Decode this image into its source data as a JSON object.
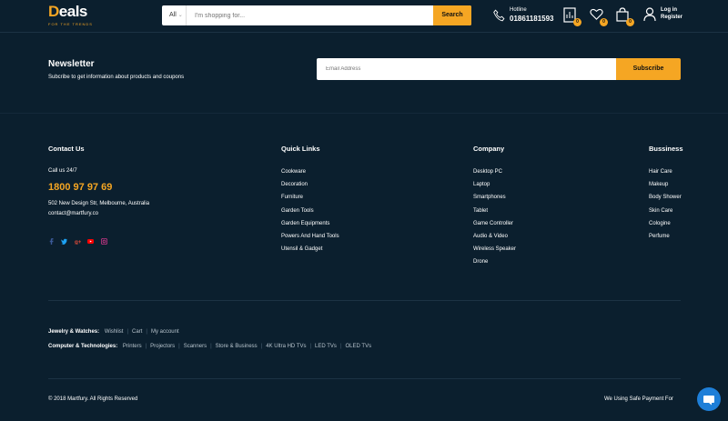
{
  "header": {
    "logo": {
      "text_prefix": "D",
      "text_rest": "eals",
      "tagline": "FOR THE TRENDS"
    },
    "search": {
      "category": "All",
      "placeholder": "I'm shopping for...",
      "button_label": "Search"
    },
    "hotline": {
      "label": "Hotline",
      "number": "01861181593",
      "icon": "phone-icon"
    },
    "icons": [
      {
        "name": "compare-icon",
        "badge": "0"
      },
      {
        "name": "wishlist-icon",
        "badge": "0"
      },
      {
        "name": "cart-icon",
        "badge": "0"
      }
    ],
    "account": {
      "login": "Log in",
      "register": "Register",
      "icon": "user-icon"
    }
  },
  "newsletter": {
    "title": "Newsletter",
    "subtitle": "Subcribe to get information about products and coupons",
    "email_placeholder": "Email Address",
    "button_label": "Subscribe"
  },
  "contact": {
    "title": "Contact Us",
    "call_label": "Call us 24/7",
    "phone": "1800 97 97 69",
    "address": "502 New Design Str, Melbourne, Australia",
    "email": "contact@martfury.co",
    "social": [
      {
        "name": "facebook-icon",
        "color": "#3b5998"
      },
      {
        "name": "twitter-icon",
        "color": "#1da1f2"
      },
      {
        "name": "google-plus-icon",
        "color": "#dd4b39"
      },
      {
        "name": "youtube-icon",
        "color": "#ff0000"
      },
      {
        "name": "instagram-icon",
        "color": "#c13584"
      }
    ]
  },
  "quick_links": {
    "title": "Quick Links",
    "items": [
      "Cookware",
      "Decoration",
      "Furniture",
      "Garden Tools",
      "Garden Equipments",
      "Powers And Hand Tools",
      "Utensil & Gadget"
    ]
  },
  "company": {
    "title": "Company",
    "items": [
      "Desktop PC",
      "Laptop",
      "Smartphones",
      "Tablet",
      "Game Controller",
      "Audio & Video",
      "Wireless Speaker",
      "Drone"
    ]
  },
  "business": {
    "title": "Bussiness",
    "items": [
      "Hair Care",
      "Makeup",
      "Body Shower",
      "Skin Care",
      "Cologine",
      "Perfume"
    ]
  },
  "bottom_links": [
    {
      "lead": "Jewelry & Watches:",
      "links": [
        "Wishlist",
        "Cart",
        "My account"
      ]
    },
    {
      "lead": "Computer & Technologies:",
      "links": [
        "Printers",
        "Projectors",
        "Scanners",
        "Store & Business",
        "4K Ultra HD TVs",
        "LED TVs",
        "OLED TVs"
      ]
    }
  ],
  "footer": {
    "copyright": "© 2018 Martfury. All Rights Reserved",
    "payment": "We Using Safe Payment For"
  },
  "colors": {
    "background": "#0b1f2e",
    "accent": "#f5a623",
    "chat": "#1e7fd8"
  }
}
